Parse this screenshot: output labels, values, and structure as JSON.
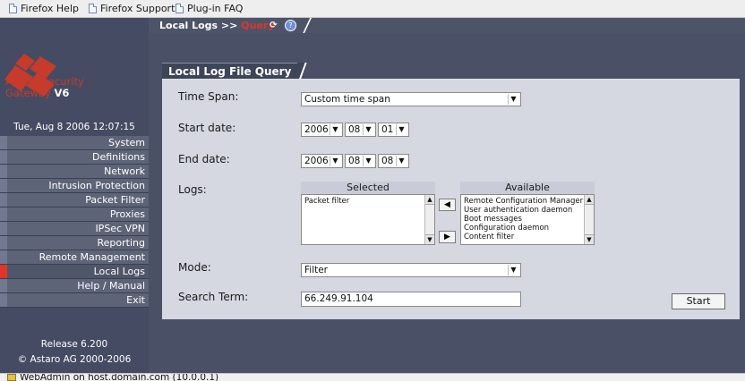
{
  "bookmarks": [
    "Firefox Help",
    "Firefox Support",
    "Plug-in FAQ"
  ],
  "brand": {
    "line1": "Astaro Security",
    "line2": "Gateway",
    "version": "V6"
  },
  "datetime": "Tue, Aug 8 2006 12:07:15",
  "menu": [
    {
      "label": "System"
    },
    {
      "label": "Definitions"
    },
    {
      "label": "Network"
    },
    {
      "label": "Intrusion Protection"
    },
    {
      "label": "Packet Filter"
    },
    {
      "label": "Proxies"
    },
    {
      "label": "IPSec VPN"
    },
    {
      "label": "Reporting"
    },
    {
      "label": "Remote Management"
    },
    {
      "label": "Local Logs",
      "active": true
    },
    {
      "label": "Help / Manual"
    },
    {
      "label": "Exit"
    }
  ],
  "release": {
    "line1": "Release 6.200",
    "line2": "© Astaro AG 2000-2006"
  },
  "breadcrumb": {
    "parent": "Local Logs >>",
    "current": "Query"
  },
  "panel_title": "Local Log File Query",
  "form": {
    "time_span_label": "Time Span:",
    "time_span_value": "Custom time span",
    "start_label": "Start date:",
    "start": {
      "year": "2006",
      "month": "08",
      "day": "01"
    },
    "end_label": "End date:",
    "end": {
      "year": "2006",
      "month": "08",
      "day": "08"
    },
    "logs_label": "Logs:",
    "selected_header": "Selected",
    "available_header": "Available",
    "selected_items": [
      "Packet filter"
    ],
    "available_items": [
      "Remote Configuration Manager",
      "User authentication daemon",
      "Boot messages",
      "Configuration daemon",
      "Content filter"
    ],
    "mode_label": "Mode:",
    "mode_value": "Filter",
    "search_label": "Search Term:",
    "search_value": "66.249.91.104",
    "start_button": "Start"
  },
  "status_text": "WebAdmin on host.domain.com (10.0.0.1)",
  "colors": {
    "accent_red": "#e0352a",
    "sidebar": "#454b62",
    "panel": "#d5d7e1"
  }
}
